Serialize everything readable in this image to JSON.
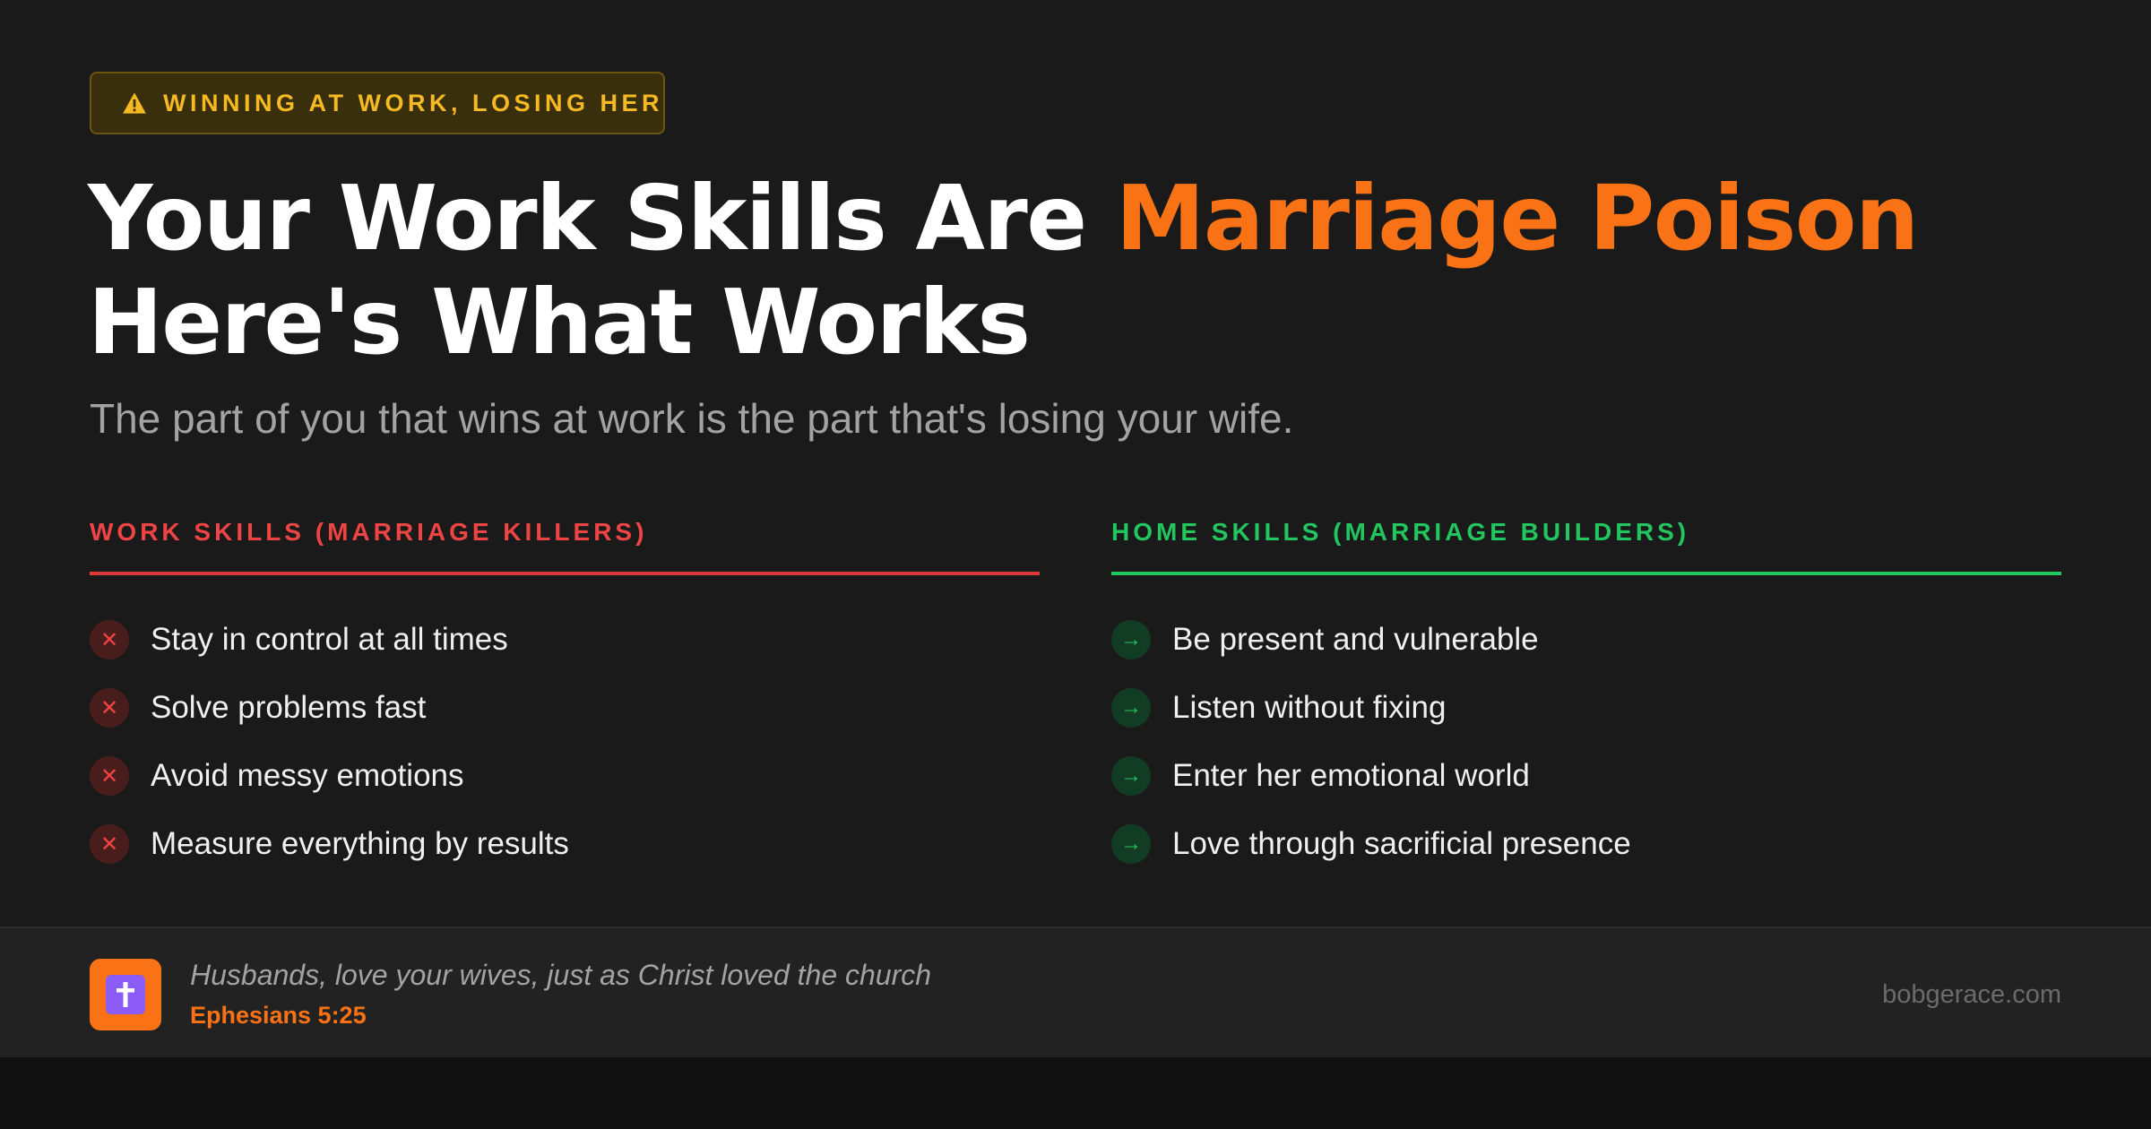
{
  "badge": {
    "icon": "warning-icon",
    "label": "WINNING AT WORK, LOSING HER"
  },
  "headline": {
    "line1_plain": "Your Work Skills Are ",
    "line1_accent": "Marriage Poison",
    "line2": "Here's What Works"
  },
  "subtitle": "The part of you that wins at work is the part that's losing your wife.",
  "work_skills": {
    "heading": "WORK SKILLS (MARRIAGE KILLERS)",
    "icon": "x-icon",
    "items": [
      "Stay in control at all times",
      "Solve problems fast",
      "Avoid messy emotions",
      "Measure everything by results"
    ]
  },
  "home_skills": {
    "heading": "HOME SKILLS (MARRIAGE BUILDERS)",
    "icon": "arrow-right-icon",
    "items": [
      "Be present and vulnerable",
      "Listen without fixing",
      "Enter her emotional world",
      "Love through sacrificial presence"
    ]
  },
  "footer": {
    "icon": "cross-icon",
    "quote": "Husbands, love your wives, just as Christ loved the church",
    "reference": "Ephesians 5:25",
    "site": "bobgerace.com"
  },
  "colors": {
    "accent_orange": "#f97316",
    "warning_yellow": "#f5b922",
    "killer_red": "#ef4444",
    "builder_green": "#22c55e",
    "background": "#1a1a1a"
  }
}
